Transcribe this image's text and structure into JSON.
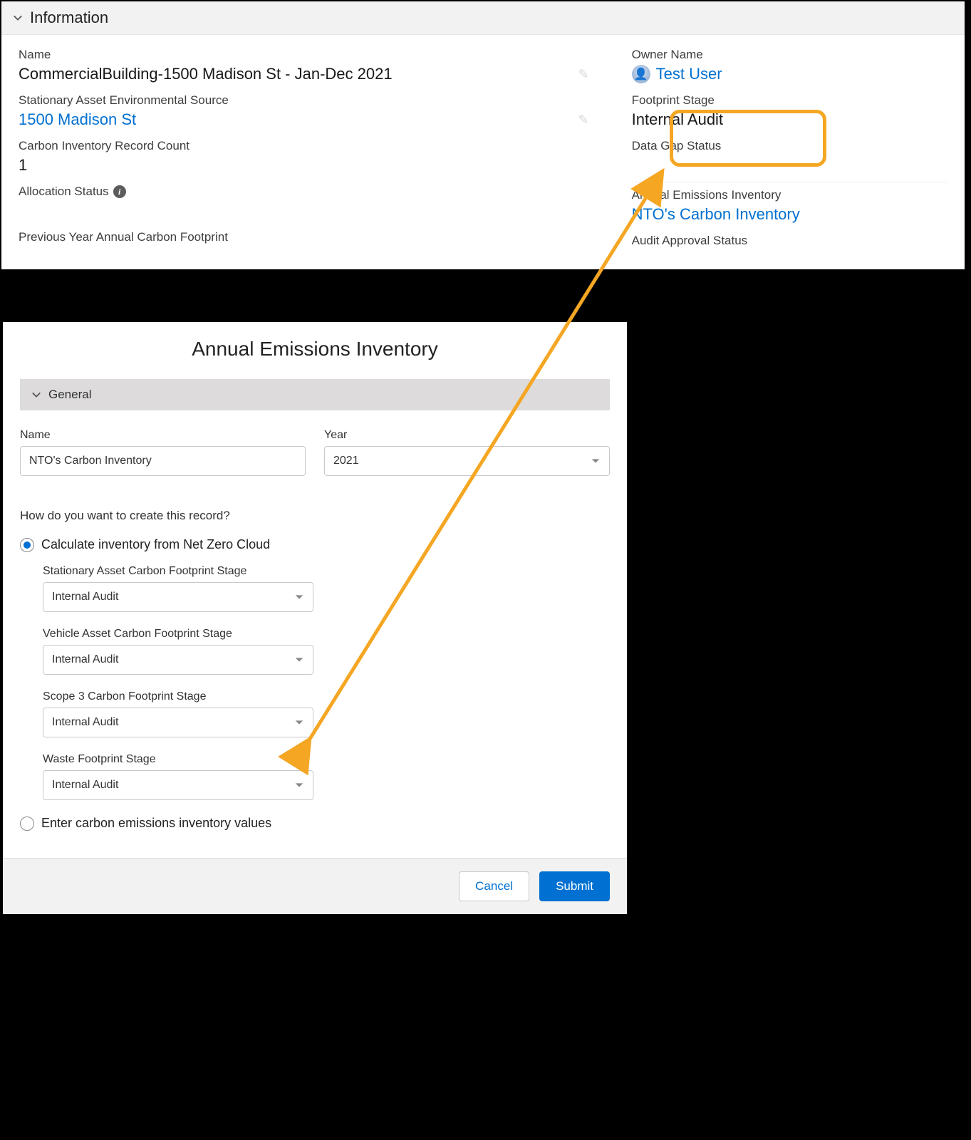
{
  "info_panel": {
    "header": "Information",
    "left": {
      "name_label": "Name",
      "name_value": "CommercialBuilding-1500 Madison St - Jan-Dec 2021",
      "source_label": "Stationary Asset Environmental Source",
      "source_value": "1500 Madison St",
      "count_label": "Carbon Inventory Record Count",
      "count_value": "1",
      "alloc_label": "Allocation Status",
      "prev_label": "Previous Year Annual Carbon Footprint"
    },
    "right": {
      "owner_label": "Owner Name",
      "owner_value": "Test User",
      "stage_label": "Footprint Stage",
      "stage_value": "Internal Audit",
      "gap_label": "Data Gap Status",
      "aei_label": "Annual Emissions Inventory",
      "aei_value": "NTO's Carbon Inventory",
      "audit_label": "Audit Approval Status"
    }
  },
  "dialog": {
    "title": "Annual Emissions Inventory",
    "general_header": "General",
    "name_label": "Name",
    "name_value": "NTO's Carbon Inventory",
    "year_label": "Year",
    "year_value": "2021",
    "how_question": "How do you want to create this record?",
    "radio_calc": "Calculate inventory from Net Zero Cloud",
    "radio_enter": "Enter carbon emissions inventory values",
    "stages": {
      "stationary_label": "Stationary Asset Carbon Footprint Stage",
      "stationary_value": "Internal Audit",
      "vehicle_label": "Vehicle Asset Carbon Footprint Stage",
      "vehicle_value": "Internal Audit",
      "scope3_label": "Scope 3 Carbon Footprint Stage",
      "scope3_value": "Internal Audit",
      "waste_label": "Waste Footprint Stage",
      "waste_value": "Internal Audit"
    },
    "cancel": "Cancel",
    "submit": "Submit"
  }
}
